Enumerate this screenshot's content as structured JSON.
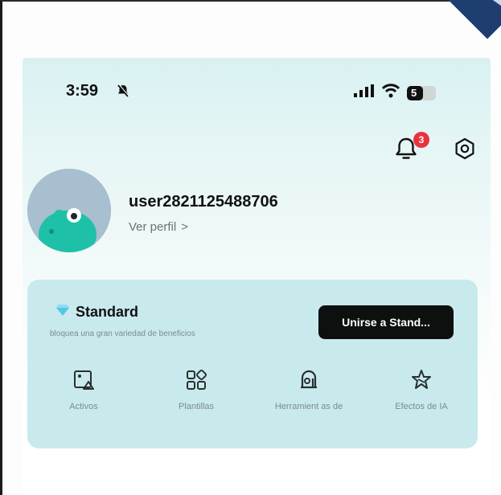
{
  "status_bar": {
    "time": "3:59",
    "battery_level": "5"
  },
  "notifications": {
    "badge_count": "3"
  },
  "profile": {
    "username": "user2821125488706",
    "view_profile_label": "Ver perfil",
    "view_profile_chevron": ">"
  },
  "membership": {
    "plan_name": "Standard",
    "subtitle": "bloquea una gran variedad de beneficios",
    "join_label": "Unirse a Stand..."
  },
  "features": [
    {
      "label": "Activos",
      "icon": "image-edit-icon"
    },
    {
      "label": "Plantillas",
      "icon": "templates-grid-icon"
    },
    {
      "label": "Herramient as de",
      "icon": "tools-icon"
    },
    {
      "label": "Efectos de IA",
      "icon": "ai-effects-icon"
    }
  ],
  "colors": {
    "header_bg": "#d9f1f2",
    "card_bg": "#c9eaed",
    "button_bg": "#0e1010",
    "badge": "#e8333e",
    "avatar_bg": "#9fb9c9",
    "avatar_character": "#1ec0a8"
  }
}
